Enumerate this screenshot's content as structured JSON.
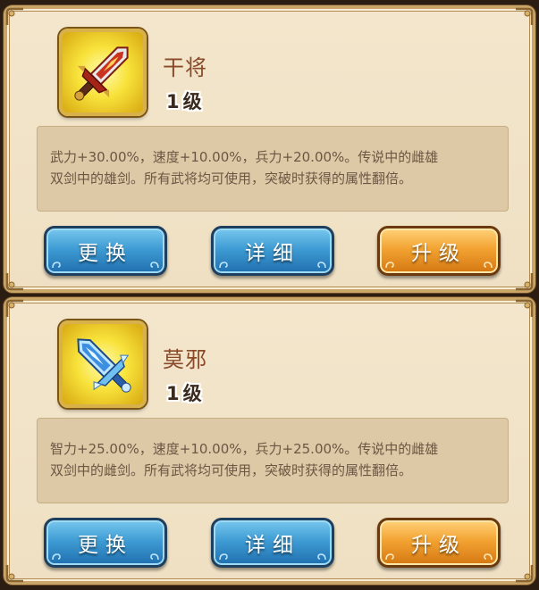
{
  "colors": {
    "panel_bg": "#f3e6cc",
    "frame_gold": "#c9a568",
    "name_text": "#8a4a2a",
    "desc_text": "#6b5744",
    "button_blue": "#3f9cd4",
    "button_orange": "#f3a332"
  },
  "weapons": [
    {
      "icon": "fire-sword-icon",
      "name": "干将",
      "level": "1级",
      "desc_line1": "武力+30.00%，速度+10.00%，兵力+20.00%。传说中的雌雄",
      "desc_line2": "双剑中的雄剑。所有武将均可使用，突破时获得的属性翻倍。",
      "buttons": {
        "replace": "更换",
        "detail": "详细",
        "upgrade": "升级"
      }
    },
    {
      "icon": "ice-sword-icon",
      "name": "莫邪",
      "level": "1级",
      "desc_line1": "智力+25.00%，速度+10.00%，兵力+25.00%。传说中的雌雄",
      "desc_line2": "双剑中的雌剑。所有武将均可使用，突破时获得的属性翻倍。",
      "buttons": {
        "replace": "更换",
        "detail": "详细",
        "upgrade": "升级"
      }
    }
  ]
}
